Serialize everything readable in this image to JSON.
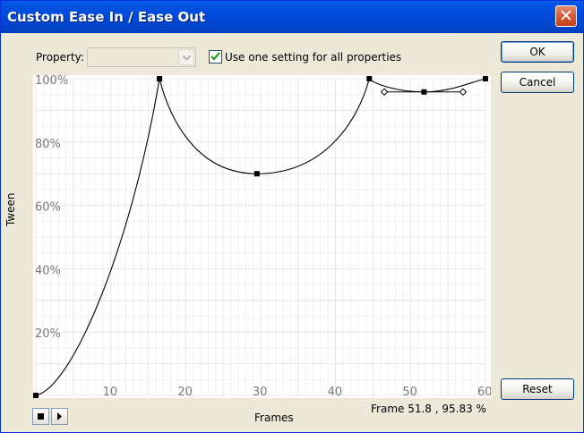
{
  "window": {
    "title": "Custom Ease In / Ease Out",
    "close_glyph": "✕"
  },
  "controls": {
    "property_label": "Property:",
    "property_value": "",
    "use_one_setting_label": "Use one setting for all properties",
    "use_one_setting_checked": true
  },
  "buttons": {
    "ok": "OK",
    "cancel": "Cancel",
    "reset": "Reset"
  },
  "graph": {
    "y_axis_label": "Tween",
    "x_axis_label": "Frames",
    "y_ticks": [
      "20%",
      "40%",
      "60%",
      "80%",
      "100%"
    ],
    "x_ticks": [
      "10",
      "20",
      "30",
      "40",
      "50",
      "60"
    ],
    "x_range": [
      0,
      60
    ],
    "y_range": [
      0,
      100
    ],
    "curve_color": "#000000",
    "grid_color": "#E8E8E8",
    "anchor_points": [
      {
        "frame": 0,
        "tween": 0
      },
      {
        "frame": 16.5,
        "tween": 100
      },
      {
        "frame": 29.5,
        "tween": 70
      },
      {
        "frame": 44.5,
        "tween": 100
      },
      {
        "frame": 51.8,
        "tween": 95.83
      },
      {
        "frame": 60,
        "tween": 100
      }
    ],
    "handle_points": [
      {
        "frame": 46.5,
        "tween": 95.83
      },
      {
        "frame": 57,
        "tween": 95.83
      }
    ],
    "readout": "Frame  51.8 ,  95.83 %"
  },
  "playback": {
    "stop_icon": "stop-icon",
    "play_icon": "play-icon"
  }
}
